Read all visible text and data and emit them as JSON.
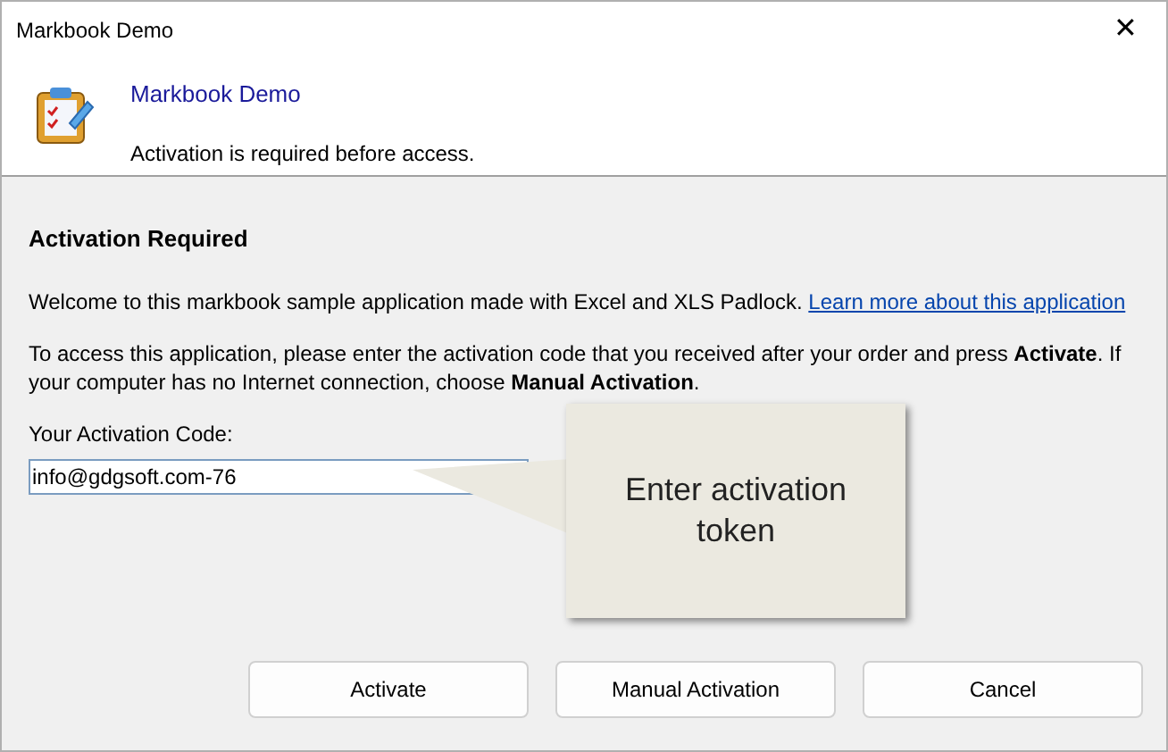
{
  "window": {
    "title": "Markbook Demo",
    "close": "✕"
  },
  "header": {
    "title": "Markbook Demo",
    "subtitle": "Activation is required before access."
  },
  "body": {
    "heading": "Activation Required",
    "welcome": "Welcome to this markbook sample application made with Excel and XLS Padlock.",
    "link": "Learn more about this application",
    "instructions": "To access this application, please enter the activation code that you received after your order and press **Activate**. If your computer has no Internet connection, choose **Manual Activation**.",
    "code_label": "Your Activation Code:",
    "code_value": "info@gdgsoft.com-76"
  },
  "callout": {
    "text": "Enter activation token"
  },
  "buttons": [
    "Activate",
    "Manual Activation",
    "Cancel"
  ]
}
